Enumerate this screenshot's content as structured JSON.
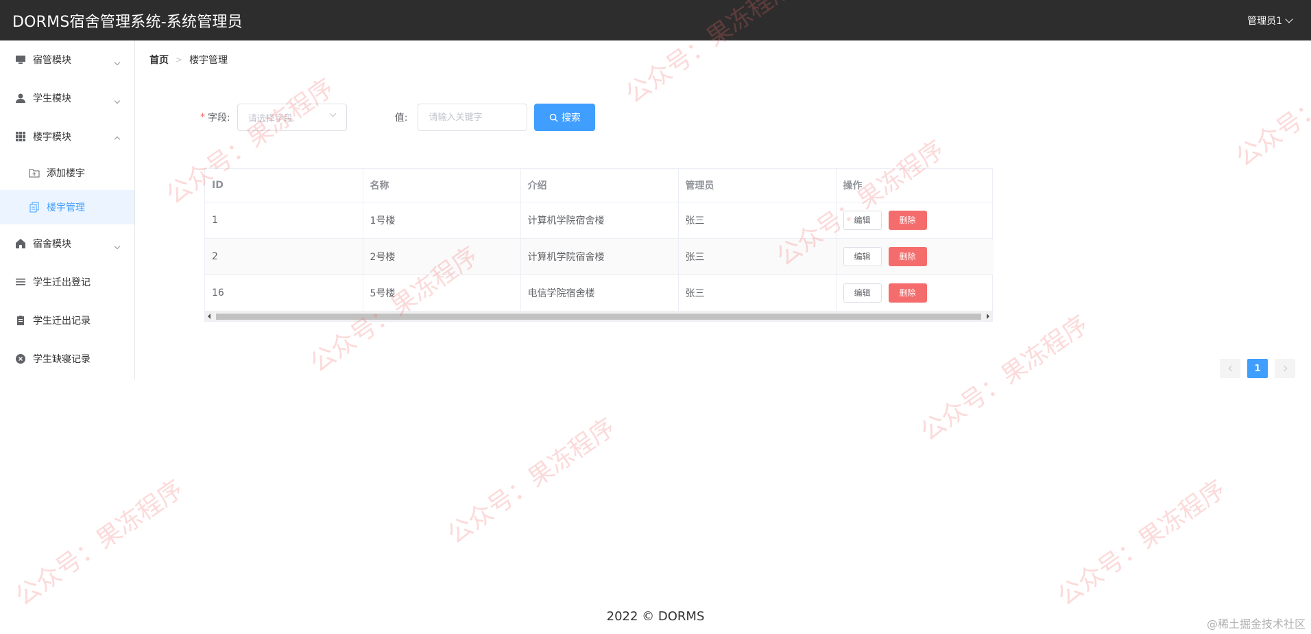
{
  "header": {
    "title": "DORMS宿舍管理系统-系统管理员",
    "user": "管理员1"
  },
  "sidebar": {
    "items": [
      {
        "label": "宿管模块",
        "icon": "monitor-icon",
        "expandable": true,
        "expanded": false
      },
      {
        "label": "学生模块",
        "icon": "user-icon",
        "expandable": true,
        "expanded": false
      },
      {
        "label": "楼宇模块",
        "icon": "grid-icon",
        "expandable": true,
        "expanded": true,
        "children": [
          {
            "label": "添加楼宇",
            "icon": "folder-add-icon",
            "active": false
          },
          {
            "label": "楼宇管理",
            "icon": "document-copy-icon",
            "active": true
          }
        ]
      },
      {
        "label": "宿舍模块",
        "icon": "house-icon",
        "expandable": true,
        "expanded": false
      },
      {
        "label": "学生迁出登记",
        "icon": "list-icon",
        "expandable": false
      },
      {
        "label": "学生迁出记录",
        "icon": "clipboard-icon",
        "expandable": false
      },
      {
        "label": "学生缺寝记录",
        "icon": "circle-close-icon",
        "expandable": false
      }
    ]
  },
  "breadcrumb": {
    "home": "首页",
    "current": "楼宇管理"
  },
  "search": {
    "field_label": "字段:",
    "field_placeholder": "请选择字段",
    "value_label": "值:",
    "value_placeholder": "请输入关键字",
    "button": "搜索"
  },
  "table": {
    "columns": [
      "ID",
      "名称",
      "介绍",
      "管理员",
      "操作"
    ],
    "rows": [
      {
        "id": "1",
        "name": "1号楼",
        "intro": "计算机学院宿舍楼",
        "admin": "张三"
      },
      {
        "id": "2",
        "name": "2号楼",
        "intro": "计算机学院宿舍楼",
        "admin": "张三"
      },
      {
        "id": "16",
        "name": "5号楼",
        "intro": "电信学院宿舍楼",
        "admin": "张三"
      }
    ],
    "edit_label": "编辑",
    "delete_label": "删除"
  },
  "pagination": {
    "current_page": "1"
  },
  "footer": {
    "text": "2022 © DORMS"
  },
  "corner_mark": "@稀土掘金技术社区",
  "watermark_text": "公众号：果冻程序",
  "colors": {
    "primary": "#409eff",
    "danger": "#f56c6c",
    "topbar": "#2d2d2d"
  }
}
